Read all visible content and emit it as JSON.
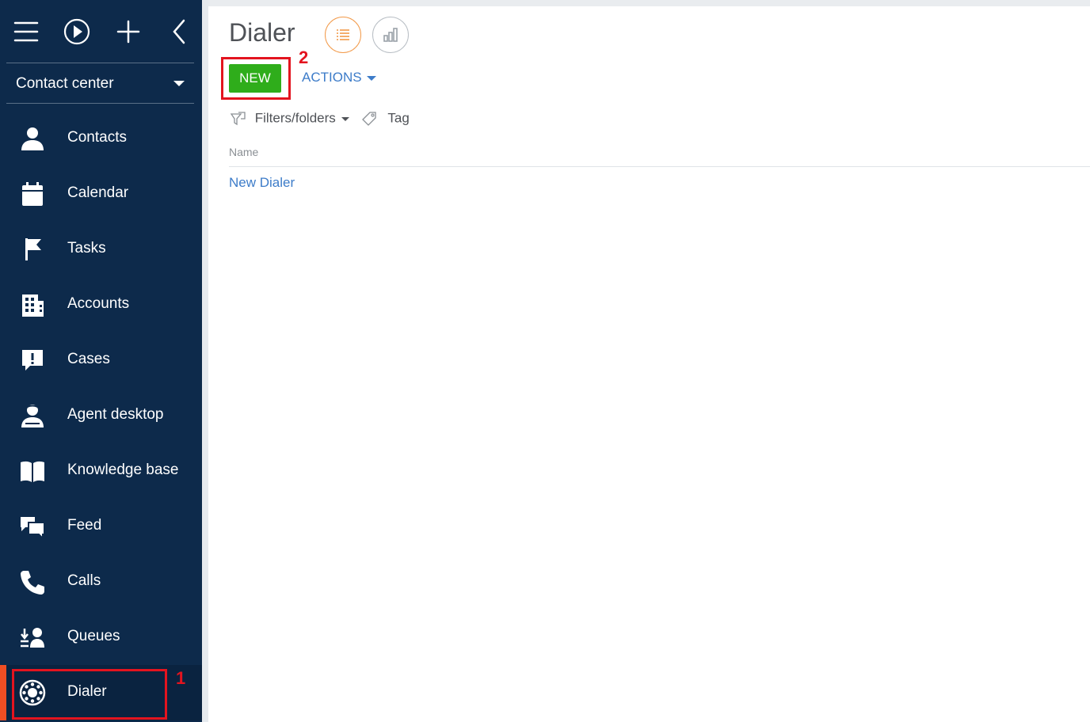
{
  "sidebar": {
    "topbar": {
      "icons": [
        "menu-icon",
        "play-icon",
        "plus-icon",
        "chevron-left-icon"
      ]
    },
    "workplace": {
      "label": "Contact center"
    },
    "items": [
      {
        "label": "Contacts",
        "icon": "person-icon"
      },
      {
        "label": "Calendar",
        "icon": "calendar-icon"
      },
      {
        "label": "Tasks",
        "icon": "flag-icon"
      },
      {
        "label": "Accounts",
        "icon": "building-icon"
      },
      {
        "label": "Cases",
        "icon": "exclamation-chat-icon"
      },
      {
        "label": "Agent desktop",
        "icon": "agent-icon"
      },
      {
        "label": "Knowledge base",
        "icon": "book-icon"
      },
      {
        "label": "Feed",
        "icon": "chat-bubbles-icon"
      },
      {
        "label": "Calls",
        "icon": "phone-icon"
      },
      {
        "label": "Queues",
        "icon": "queue-icon"
      },
      {
        "label": "Dialer",
        "icon": "rotary-dialer-icon",
        "active": true
      }
    ],
    "annotation": "1"
  },
  "main": {
    "title": "Dialer",
    "views": [
      "list-view-icon",
      "analytics-view-icon"
    ],
    "toolbar": {
      "new_label": "NEW",
      "actions_label": "ACTIONS",
      "annotation": "2"
    },
    "filters": {
      "filters_label": "Filters/folders",
      "tag_label": "Tag"
    },
    "grid": {
      "columns": [
        "Name"
      ],
      "rows": [
        {
          "name": "New Dialer"
        }
      ]
    }
  },
  "colors": {
    "sidebar_bg": "#0d2a4b",
    "accent_new": "#2fad1b",
    "link": "#3d7cc9",
    "highlight": "#e3141f",
    "active_bar": "#f04e23"
  }
}
